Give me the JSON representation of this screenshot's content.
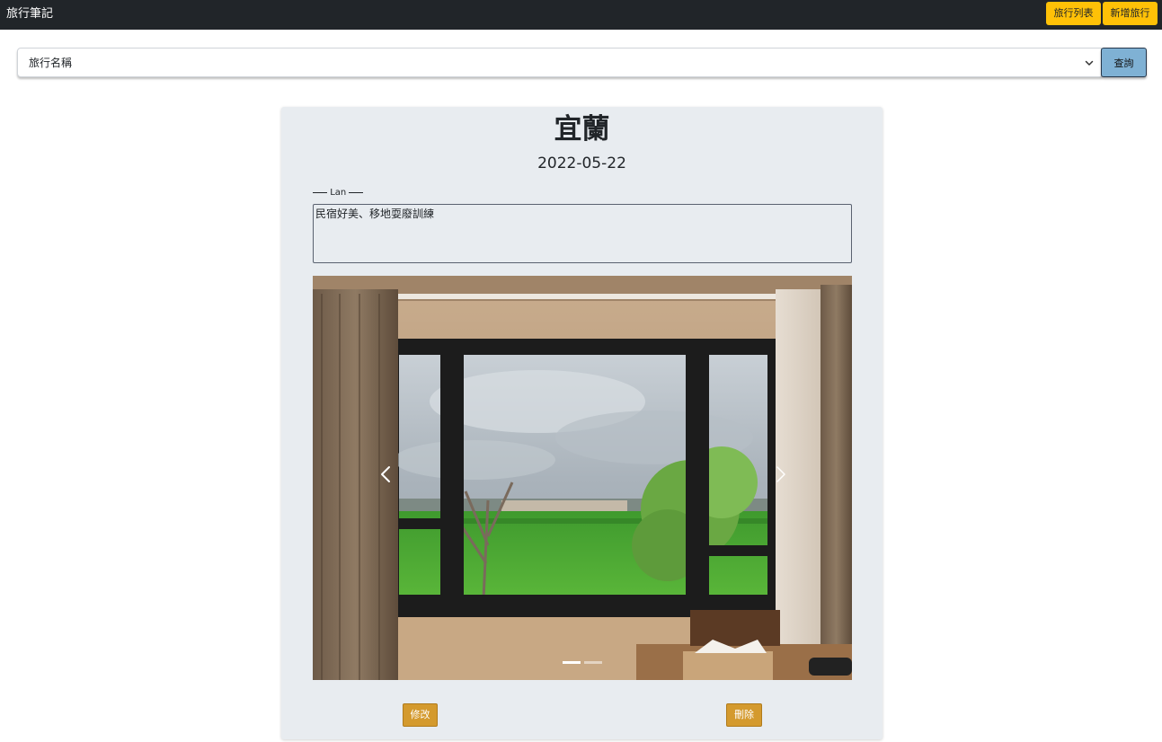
{
  "navbar": {
    "brand": "旅行筆記",
    "list_button": "旅行列表",
    "add_button": "新增旅行"
  },
  "search": {
    "select_value": "旅行名稱",
    "query_button": "查詢"
  },
  "trip": {
    "title": "宜蘭",
    "date": "2022-05-22",
    "author": "Lan",
    "note": "民宿好美、移地耍廢訓練",
    "photo_count": 2,
    "active_photo": 1
  },
  "actions": {
    "edit_label": "修改",
    "delete_label": "刪除"
  },
  "colors": {
    "navbar_bg": "#212529",
    "nav_button": "#ffc107",
    "query_button": "#7fb1d4",
    "card_bg": "#e8ecf0",
    "action_button": "#d49a2e"
  },
  "icons": {
    "select_chevron": "chevron-down-icon",
    "carousel_prev": "chevron-left-icon",
    "carousel_next": "chevron-right-icon"
  }
}
